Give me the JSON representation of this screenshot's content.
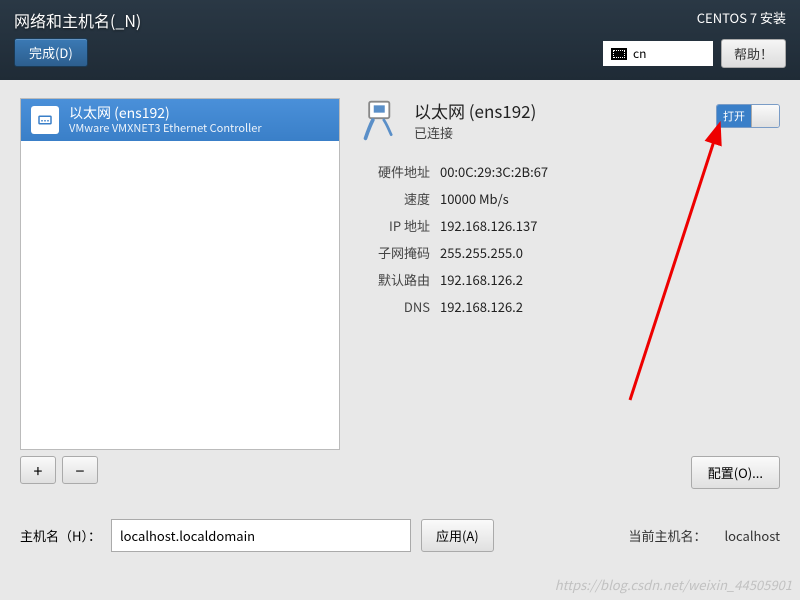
{
  "header": {
    "title": "网络和主机名(_N)",
    "done": "完成(D)",
    "install": "CENTOS 7 安装",
    "keyboard": "cn",
    "help": "帮助！"
  },
  "device": {
    "name": "以太网 (ens192)",
    "sub": "VMware VMXNET3 Ethernet Controller"
  },
  "buttons": {
    "add": "+",
    "remove": "−",
    "config": "配置(O)...",
    "apply": "应用(A)"
  },
  "detail": {
    "title": "以太网 (ens192)",
    "status": "已连接",
    "toggle": "打开"
  },
  "info": {
    "hw_label": "硬件地址",
    "hw": "00:0C:29:3C:2B:67",
    "speed_label": "速度",
    "speed": "10000 Mb/s",
    "ip_label": "IP 地址",
    "ip": "192.168.126.137",
    "mask_label": "子网掩码",
    "mask": "255.255.255.0",
    "gw_label": "默认路由",
    "gw": "192.168.126.2",
    "dns_label": "DNS",
    "dns": "192.168.126.2"
  },
  "hostname": {
    "label": "主机名（H）：",
    "value": "localhost.localdomain",
    "current_label": "当前主机名：",
    "current": "localhost"
  },
  "watermark": "https://blog.csdn.net/weixin_44505901"
}
